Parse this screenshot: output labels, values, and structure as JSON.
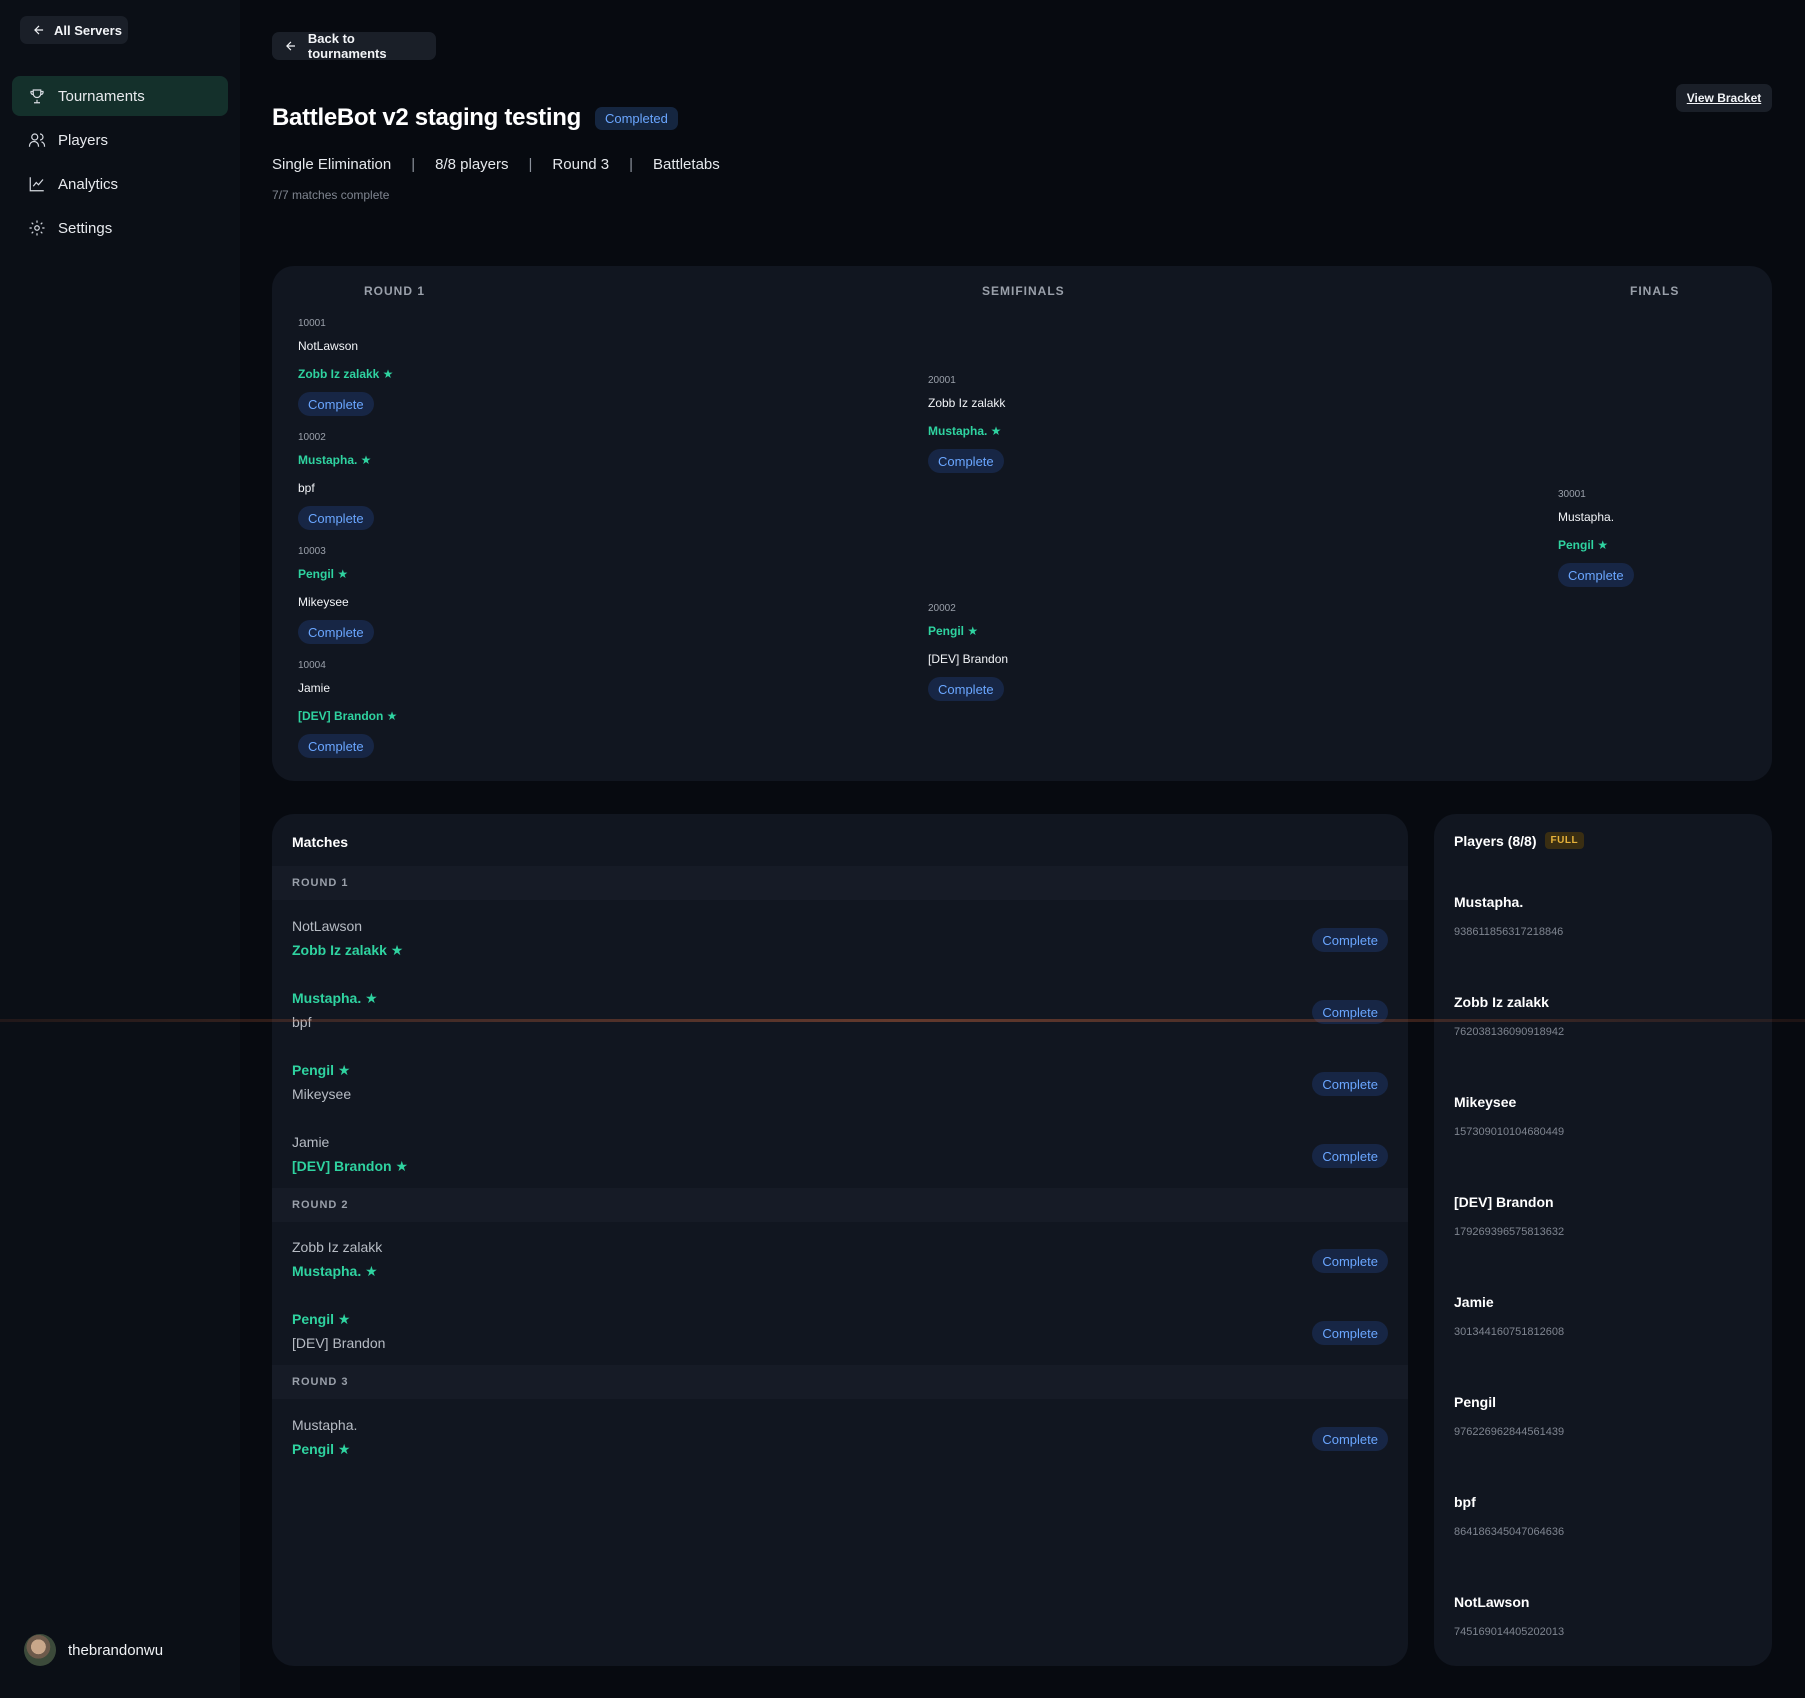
{
  "sidebar": {
    "all_servers": "All Servers",
    "nav": [
      {
        "label": "Tournaments",
        "icon": "trophy-icon",
        "active": true
      },
      {
        "label": "Players",
        "icon": "users-icon",
        "active": false
      },
      {
        "label": "Analytics",
        "icon": "chart-icon",
        "active": false
      },
      {
        "label": "Settings",
        "icon": "gear-icon",
        "active": false
      }
    ],
    "username": "thebrandonwu"
  },
  "header": {
    "back_label": "Back to tournaments",
    "title": "BattleBot v2 staging testing",
    "status": "Completed",
    "view_bracket": "View Bracket",
    "format": "Single Elimination",
    "players": "8/8 players",
    "round": "Round 3",
    "game": "Battletabs",
    "progress": "7/7 matches complete"
  },
  "bracket": {
    "rounds": [
      "ROUND 1",
      "SEMIFINALS",
      "FINALS"
    ],
    "round1": [
      {
        "id": "10001",
        "p1": "NotLawson",
        "p2": "Zobb Iz zalakk ★",
        "status": "Complete"
      },
      {
        "id": "10002",
        "p1": "Mustapha. ★",
        "p2": "bpf",
        "status": "Complete"
      },
      {
        "id": "10003",
        "p1": "Pengil ★",
        "p2": "Mikeysee",
        "status": "Complete"
      },
      {
        "id": "10004",
        "p1": "Jamie",
        "p2": "[DEV] Brandon ★",
        "status": "Complete"
      }
    ],
    "semis": [
      {
        "id": "20001",
        "p1": "Zobb Iz zalakk",
        "p2": "Mustapha. ★",
        "status": "Complete"
      },
      {
        "id": "20002",
        "p1": "Pengil ★",
        "p2": "[DEV] Brandon",
        "status": "Complete"
      }
    ],
    "finals": [
      {
        "id": "30001",
        "p1": "Mustapha.",
        "p2": "Pengil ★",
        "status": "Complete"
      }
    ]
  },
  "matches": {
    "title": "Matches",
    "rounds": [
      "ROUND 1",
      "ROUND 2",
      "ROUND 3"
    ],
    "r1": [
      {
        "p1": "NotLawson",
        "p2": "Zobb Iz zalakk ★",
        "status": "Complete"
      },
      {
        "p1": "Mustapha. ★",
        "p2": "bpf",
        "status": "Complete"
      },
      {
        "p1": "Pengil ★",
        "p2": "Mikeysee",
        "status": "Complete"
      },
      {
        "p1": "Jamie",
        "p2": "[DEV] Brandon ★",
        "status": "Complete"
      }
    ],
    "r2": [
      {
        "p1": "Zobb Iz zalakk",
        "p2": "Mustapha. ★",
        "status": "Complete"
      },
      {
        "p1": "Pengil ★",
        "p2": "[DEV] Brandon",
        "status": "Complete"
      }
    ],
    "r3": [
      {
        "p1": "Mustapha.",
        "p2": "Pengil ★",
        "status": "Complete"
      }
    ]
  },
  "players": {
    "title": "Players (8/8)",
    "badge": "FULL",
    "list": [
      {
        "name": "Mustapha.",
        "id": "938611856317218846"
      },
      {
        "name": "Zobb Iz zalakk",
        "id": "762038136090918942"
      },
      {
        "name": "Mikeysee",
        "id": "157309010104680449"
      },
      {
        "name": "[DEV] Brandon",
        "id": "179269396575813632"
      },
      {
        "name": "Jamie",
        "id": "301344160751812608"
      },
      {
        "name": "Pengil",
        "id": "976226962844561439"
      },
      {
        "name": "bpf",
        "id": "864186345047064636"
      },
      {
        "name": "NotLawson",
        "id": "745169014405202013"
      }
    ]
  },
  "colors": {
    "background": "#070a10",
    "panel": "#111620",
    "winner": "#2fd3a0",
    "status_blue": "#6aa6ff",
    "active_nav": "#14302b"
  }
}
